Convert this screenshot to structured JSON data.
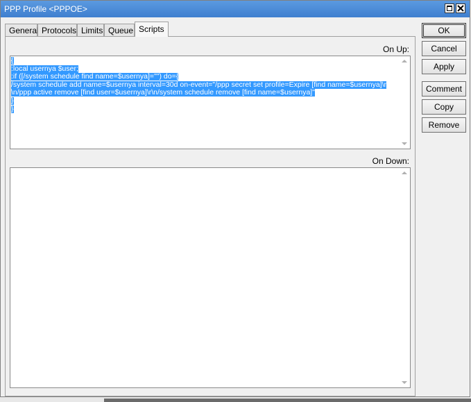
{
  "window": {
    "title": "PPP Profile <PPPOE>"
  },
  "tabs": [
    {
      "label": "General"
    },
    {
      "label": "Protocols"
    },
    {
      "label": "Limits"
    },
    {
      "label": "Queue"
    },
    {
      "label": "Scripts"
    }
  ],
  "active_tab": "Scripts",
  "on_up": {
    "label": "On Up:",
    "lines": [
      "{",
      ":local usernya $user;",
      ":if ([/system schedule find name=$usernya]=\"\") do={",
      "/system schedule add name=$usernya interval=30d on-event=\"/ppp secret set profile=Expire [find name=$usernya]\\r",
      "\\n/ppp active remove [find user=$usernya]\\r\\n/system schedule remove [find name=$usernya]\"",
      "}",
      "}"
    ]
  },
  "on_down": {
    "label": "On Down:",
    "value": ""
  },
  "buttons": {
    "ok": "OK",
    "cancel": "Cancel",
    "apply": "Apply",
    "comment": "Comment",
    "copy": "Copy",
    "remove": "Remove"
  },
  "colors": {
    "titlebar": "#4a8ad8",
    "selection": "#3399ff"
  }
}
